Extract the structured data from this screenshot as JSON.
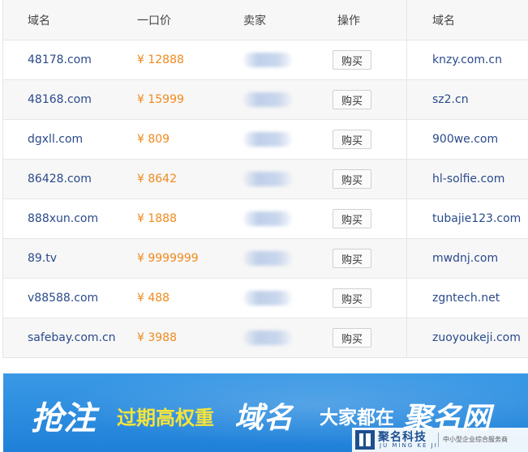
{
  "table": {
    "headers": {
      "domain": "域名",
      "price": "一口价",
      "seller": "卖家",
      "operation": "操作",
      "domain2": "域名"
    },
    "rows": [
      {
        "domain": "48178.com",
        "price": "¥ 12888",
        "buy_label": "购买",
        "domain2": "knzy.com.cn"
      },
      {
        "domain": "48168.com",
        "price": "¥ 15999",
        "buy_label": "购买",
        "domain2": "sz2.cn"
      },
      {
        "domain": "dgxll.com",
        "price": "¥ 809",
        "buy_label": "购买",
        "domain2": "900we.com"
      },
      {
        "domain": "86428.com",
        "price": "¥ 8642",
        "buy_label": "购买",
        "domain2": "hl-solfie.com"
      },
      {
        "domain": "888xun.com",
        "price": "¥ 1888",
        "buy_label": "购买",
        "domain2": "tubajie123.com"
      },
      {
        "domain": "89.tv",
        "price": "¥ 9999999",
        "buy_label": "购买",
        "domain2": "mwdnj.com"
      },
      {
        "domain": "v88588.com",
        "price": "¥ 488",
        "buy_label": "购买",
        "domain2": "zgntech.net"
      },
      {
        "domain": "safebay.com.cn",
        "price": "¥ 3988",
        "buy_label": "购买",
        "domain2": "zuoyoukeji.com"
      }
    ]
  },
  "banner": {
    "part1": "抢注",
    "part2": "过期高权重",
    "part3": "域名",
    "part4": "大家都在",
    "part5": "聚名网",
    "colors": {
      "background": "#2a8ee0",
      "highlight": "#f6e43a",
      "text": "#ffffff"
    }
  },
  "logo": {
    "icon": "jm-logo-icon",
    "name": "聚名科技",
    "sub": "JU MING KE JI",
    "slogan": "中小型企业综合服务商"
  }
}
